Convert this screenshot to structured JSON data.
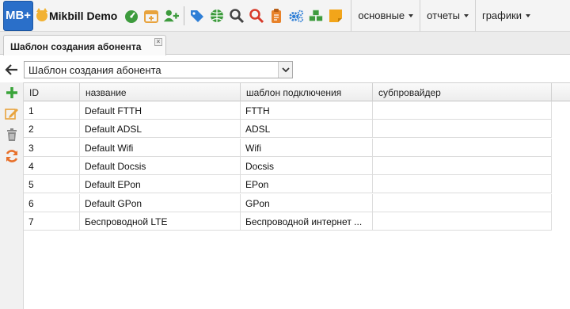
{
  "brand": {
    "logo_text": "MB+",
    "name": "Mikbill Demo"
  },
  "nav_icons": [
    {
      "name": "dashboard-icon",
      "color": "#3d9b3d"
    },
    {
      "name": "calendar-add-icon",
      "color": "#e8a33d"
    },
    {
      "name": "add-user-icon",
      "color": "#3d9b3d"
    },
    {
      "name": "tags-icon",
      "color": "#2f7fd6"
    },
    {
      "name": "globe-icon",
      "color": "#3d9b3d"
    },
    {
      "name": "search-icon",
      "color": "#444444"
    },
    {
      "name": "search-red-icon",
      "color": "#d83a2a"
    },
    {
      "name": "clipboard-icon",
      "color": "#e8822a"
    },
    {
      "name": "cogs-icon",
      "color": "#2f7fd6"
    },
    {
      "name": "cubes-icon",
      "color": "#3d9b3d"
    },
    {
      "name": "sticky-note-icon",
      "color": "#f2a51a"
    }
  ],
  "menu": [
    {
      "label": "основные"
    },
    {
      "label": "отчеты"
    },
    {
      "label": "графики"
    }
  ],
  "tab": {
    "label": "Шаблон создания абонента",
    "close": "×"
  },
  "select": {
    "value": "Шаблон создания абонента"
  },
  "side_actions": [
    {
      "name": "add-icon",
      "color": "#3aa43a"
    },
    {
      "name": "edit-icon",
      "color": "#e8a33d"
    },
    {
      "name": "delete-icon",
      "color": "#888888"
    },
    {
      "name": "refresh-icon",
      "color": "#e8702a"
    }
  ],
  "table": {
    "columns": [
      "ID",
      "название",
      "шаблон подключения",
      "субпровайдер"
    ],
    "rows": [
      [
        "1",
        "Default FTTH",
        "FTTH",
        ""
      ],
      [
        "2",
        "Default ADSL",
        "ADSL",
        ""
      ],
      [
        "3",
        "Default Wifi",
        "Wifi",
        ""
      ],
      [
        "4",
        "Default Docsis",
        "Docsis",
        ""
      ],
      [
        "5",
        "Default EPon",
        "EPon",
        ""
      ],
      [
        "6",
        "Default GPon",
        "GPon",
        ""
      ],
      [
        "7",
        "Беспроводной LTE",
        "Беспроводной интернет ...",
        ""
      ]
    ]
  }
}
